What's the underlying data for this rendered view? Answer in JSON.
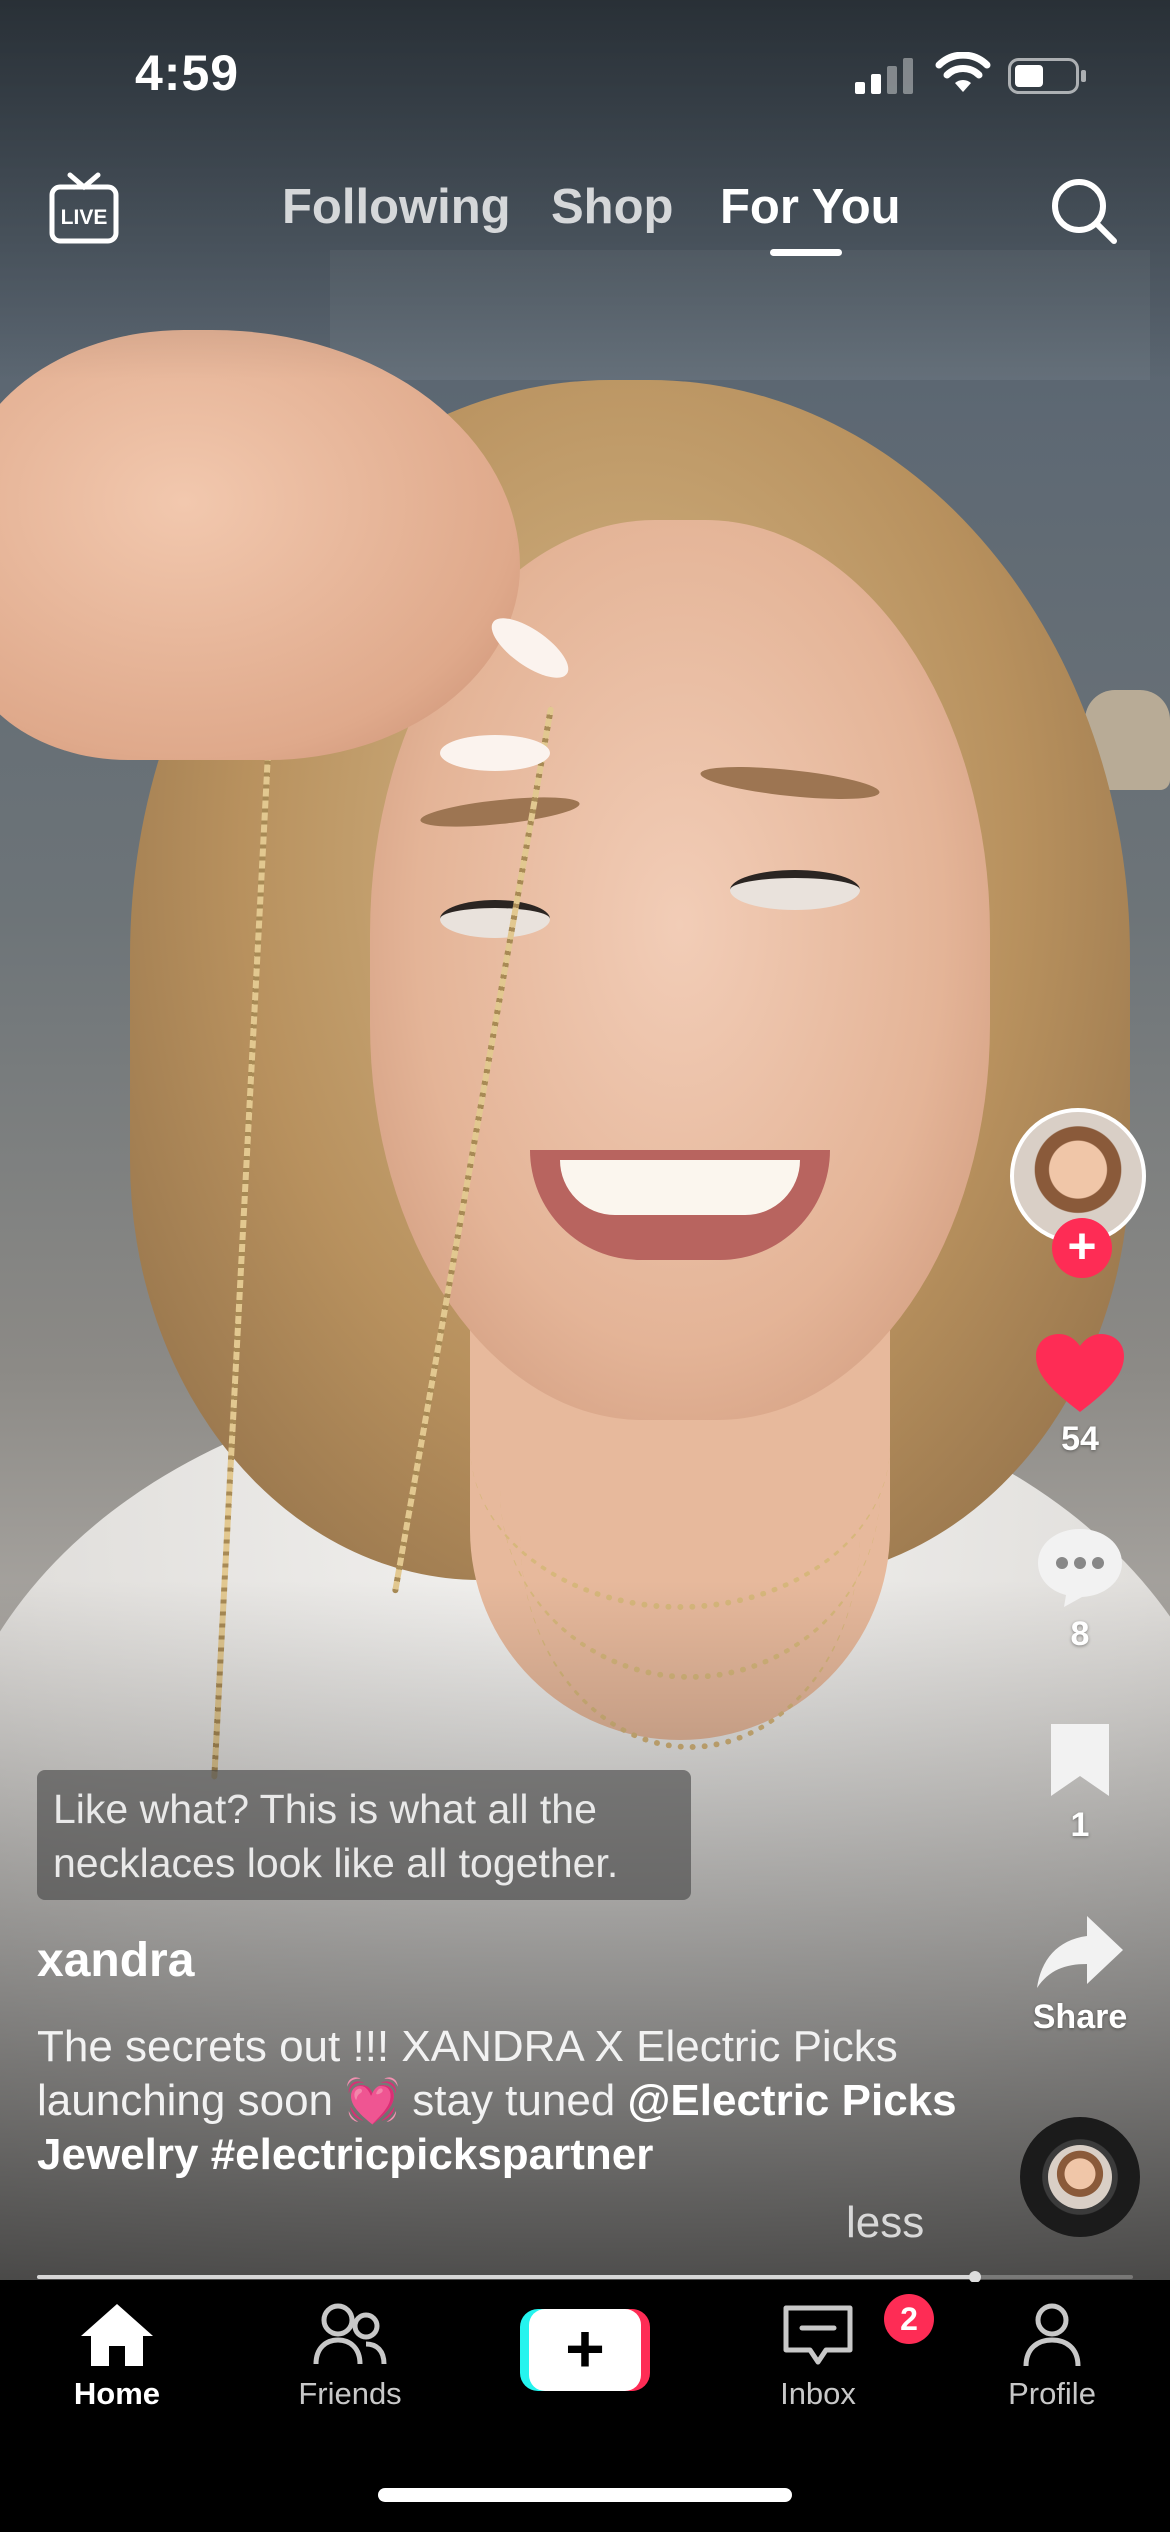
{
  "status_bar": {
    "time": "4:59",
    "icons": [
      "cellular-signal-icon",
      "wifi-icon",
      "battery-icon"
    ]
  },
  "top_nav": {
    "live_label": "LIVE",
    "tabs": [
      {
        "label": "Following",
        "active": false
      },
      {
        "label": "Shop",
        "active": false
      },
      {
        "label": "For You",
        "active": true
      }
    ],
    "search_icon": "search-icon"
  },
  "video": {
    "sticker_caption_line1": "Like what? This is what all the",
    "sticker_caption_line2": "necklaces look like all together.",
    "progress_fraction": 0.856
  },
  "post": {
    "username": "xandra",
    "description_text": "The secrets out !!! XANDRA X Electric Picks launching soon 💓 stay tuned",
    "mention": "@Electric Picks Jewelry",
    "hashtag": "#electricpickspartner",
    "less_label": "less"
  },
  "actions": {
    "follow_icon": "plus-icon",
    "likes": "54",
    "comments": "8",
    "saves": "1",
    "share_label": "Share"
  },
  "tab_bar": {
    "home": "Home",
    "friends": "Friends",
    "create_icon": "plus-icon",
    "inbox": "Inbox",
    "inbox_badge": "2",
    "profile": "Profile"
  },
  "colors": {
    "accent_red": "#fe2c55",
    "accent_cyan": "#25f4ee",
    "tab_bar_bg": "#000000"
  }
}
